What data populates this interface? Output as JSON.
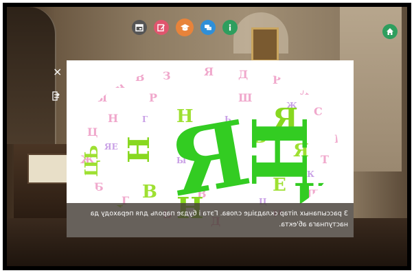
{
  "toolbar": {
    "icons": [
      {
        "name": "calendar-icon",
        "color": "#555555"
      },
      {
        "name": "edit-icon",
        "color": "#e0556e"
      },
      {
        "name": "graduation-cap-icon",
        "color": "#e8833a"
      },
      {
        "name": "chat-icon",
        "color": "#2f8fd8"
      },
      {
        "name": "info-icon",
        "color": "#2e9e5e"
      }
    ],
    "home_color": "#2e9e5e"
  },
  "modal": {
    "close_label": "×",
    "caption": "З рассыпаных літар складзіце слова. Гэта і будзе пароль для пераходу да наступнага аб'екта."
  },
  "wordcloud": {
    "letters_green": [
      "Н",
      "Я",
      "Ц",
      "Ь",
      "Н",
      "Я",
      "Е",
      "Н",
      "Ц",
      "Ь"
    ],
    "letters_pink": [
      "Ы",
      "К",
      "В",
      "З",
      "Я",
      "Д",
      "Р",
      "Л",
      "С",
      "Ц",
      "Ж",
      "Б",
      "Г",
      "Ь",
      "Н",
      "Ш",
      "Т"
    ],
    "colors": {
      "green": "#33cc22",
      "lime": "#9ee032",
      "pink": "#f0a8cc",
      "violet": "#c9a0e6"
    }
  }
}
